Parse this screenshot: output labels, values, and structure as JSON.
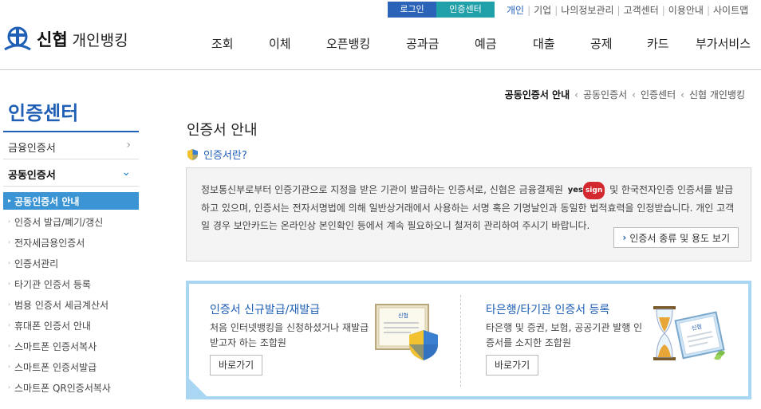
{
  "utility": {
    "login": "로그인",
    "cert_center": "인증센터",
    "links": [
      "개인",
      "기업",
      "나의정보관리",
      "고객센터",
      "이용안내",
      "사이트맵"
    ]
  },
  "logo": {
    "name": "신협",
    "sub": "개인뱅킹"
  },
  "gnb": [
    "조회",
    "이체",
    "오픈뱅킹",
    "공과금",
    "예금",
    "대출",
    "공제",
    "카드",
    "부가서비스"
  ],
  "breadcrumb": [
    "공동인증서 안내",
    "공동인증서",
    "인증센터",
    "신협 개인뱅킹"
  ],
  "sidebar": {
    "title": "인증센터",
    "groups": [
      {
        "label": "금융인증서",
        "chevron": "›"
      },
      {
        "label": "공동인증서",
        "chevron": "⌄"
      }
    ],
    "items": [
      "공동인증서 안내",
      "인증서 발급/폐기/갱신",
      "전자세금용인증서",
      "인증서관리",
      "타기관 인증서 등록",
      "범용 인증서 세금계산서",
      "휴대폰 인증서 안내",
      "스마트폰 인증서복사",
      "스마트폰 인증서발급",
      "스마트폰 QR인증서복사"
    ]
  },
  "main": {
    "title": "인증서 안내",
    "section_title": "인증서란?",
    "info_part1": "정보통신부로부터 인증기관으로 지정을 받은 기관이 발급하는 인증서로, 신협은 금융결제원",
    "yessign_yes": "yes",
    "yessign_sign": "sign",
    "info_part2": "및 한국전자인증 인증서를 발급하고 있으며, 인증서는 전자서명법에 의해 일반상거래에서 사용하는 서명 혹은 기명날인과 동일한 법적효력을 인정받습니다. 개인 고객일 경우 보안카드는 온라인상 본인확인 등에서 계속 필요하오니 철저히 관리하여 주시기 바랍니다.",
    "info_button": "인증서 종류 및 용도 보기",
    "cards": [
      {
        "title": "인증서 신규발급/재발급",
        "desc": "처음 인터넷뱅킹을 신청하셨거나 재발급 받고자 하는 조합원",
        "button": "바로가기",
        "doc_label": "신협"
      },
      {
        "title": "타은행/타기관 인증서 등록",
        "desc": "타은행 및 증권, 보험, 공공기관 발행 인증서를 소지한 조합원",
        "button": "바로가기",
        "doc_label": "신협"
      }
    ]
  },
  "colors": {
    "brand": "#1f5fb5",
    "login_bg": "#2a63b8",
    "cert_bg": "#20a0a8",
    "active_nav": "#3b95d4",
    "card_border": "#a9d6f2"
  }
}
